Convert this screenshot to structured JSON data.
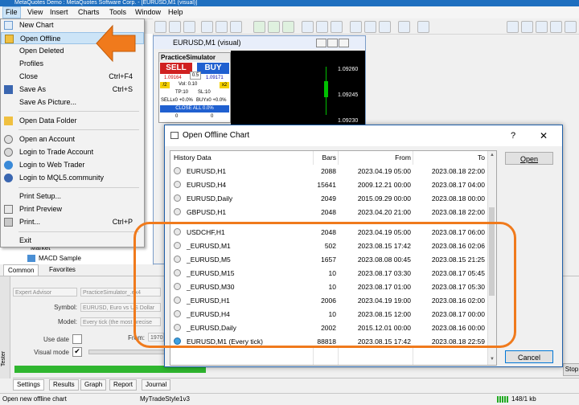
{
  "window_title": "MetaQuotes Demo : MetaQuotes Software Corp. - [EURUSD,M1 (visual)]",
  "menubar": [
    "File",
    "View",
    "Insert",
    "Charts",
    "Tools",
    "Window",
    "Help"
  ],
  "file_menu": [
    {
      "label": "New Chart",
      "shortcut": "",
      "icon": "new-chart-icon"
    },
    {
      "label": "Open Offline",
      "shortcut": "",
      "icon": "open-folder-icon"
    },
    {
      "label": "Open Deleted",
      "shortcut": "",
      "icon": ""
    },
    {
      "label": "Profiles",
      "shortcut": "",
      "icon": ""
    },
    {
      "label": "Close",
      "shortcut": "Ctrl+F4",
      "icon": ""
    },
    {
      "label": "Save As",
      "shortcut": "Ctrl+S",
      "icon": "save-icon"
    },
    {
      "label": "Save As Picture...",
      "shortcut": "",
      "icon": ""
    },
    {
      "label": "Open Data Folder",
      "shortcut": "",
      "icon": "folder-icon"
    },
    {
      "label": "Open an Account",
      "shortcut": "",
      "icon": "account-icon"
    },
    {
      "label": "Login to Trade Account",
      "shortcut": "",
      "icon": "login-icon"
    },
    {
      "label": "Login to Web Trader",
      "shortcut": "",
      "icon": "web-icon"
    },
    {
      "label": "Login to MQL5.community",
      "shortcut": "",
      "icon": "mql5-icon"
    },
    {
      "label": "Print Setup...",
      "shortcut": "",
      "icon": ""
    },
    {
      "label": "Print Preview",
      "shortcut": "",
      "icon": "print-preview-icon"
    },
    {
      "label": "Print...",
      "shortcut": "Ctrl+P",
      "icon": "print-icon"
    },
    {
      "label": "Exit",
      "shortcut": "",
      "icon": ""
    }
  ],
  "chart_window": {
    "title": "EURUSD,M1 (visual)",
    "prices": [
      "1.09260",
      "1.09245",
      "1.09230"
    ],
    "simulator": {
      "title": "PracticeSimulator",
      "sell": "SELL",
      "buy": "BUY",
      "bid": "1.09164",
      "spread": "0.5",
      "ask": "1.09171",
      "half": "/2",
      "vol": "Vol: 0.10",
      "double": "x2",
      "tp": "TP:10",
      "sl": "SL:10",
      "sell_pct": "SELLx0 +0.0%",
      "buy_pct": "BUYx0 +0.0%",
      "close_all": "CLOSE ALL 0.0%",
      "zero_left": "0",
      "zero_right": "0"
    }
  },
  "navigator": {
    "tree_items": [
      "Market",
      "MACD Sample"
    ],
    "tabs": [
      "Common",
      "Favorites"
    ]
  },
  "tester": {
    "type": "Expert Advisor",
    "ea": "PracticeSimulator_.ex4",
    "symbol_label": "Symbol:",
    "symbol": "EURUSD, Euro vs US Dollar",
    "model_label": "Model:",
    "model": "Every tick (the most precise",
    "use_date_label": "Use date",
    "from_label": "From:",
    "from_value": "1970",
    "visual_label": "Visual mode",
    "stop_button": "Stop",
    "side_label": "Tester",
    "tabs": [
      "Settings",
      "Results",
      "Graph",
      "Report",
      "Journal"
    ]
  },
  "status": {
    "left": "Open new offline chart",
    "profile": "MyTradeStyle1v3",
    "traffic": "148/1 kb"
  },
  "dialog": {
    "title": "Open Offline Chart",
    "help": "?",
    "close": "✕",
    "columns": [
      "History Data",
      "Bars",
      "From",
      "To"
    ],
    "rows": [
      [
        "EURUSD,H1",
        "2088",
        "2023.04.19 05:00",
        "2023.08.18 22:00"
      ],
      [
        "EURUSD,H4",
        "15641",
        "2009.12.21 00:00",
        "2023.08.17 04:00"
      ],
      [
        "EURUSD,Daily",
        "2049",
        "2015.09.29 00:00",
        "2023.08.18 00:00"
      ],
      [
        "GBPUSD,H1",
        "2048",
        "2023.04.20 21:00",
        "2023.08.18 22:00"
      ],
      [
        "USDCHF,H1",
        "2048",
        "2023.04.19 05:00",
        "2023.08.17 06:00"
      ],
      [
        "_EURUSD,M1",
        "502",
        "2023.08.15 17:42",
        "2023.08.16 02:06"
      ],
      [
        "_EURUSD,M5",
        "1657",
        "2023.08.08 00:45",
        "2023.08.15 21:25"
      ],
      [
        "_EURUSD,M15",
        "10",
        "2023.08.17 03:30",
        "2023.08.17 05:45"
      ],
      [
        "_EURUSD,M30",
        "10",
        "2023.08.17 01:00",
        "2023.08.17 05:30"
      ],
      [
        "_EURUSD,H1",
        "2006",
        "2023.04.19 19:00",
        "2023.08.16 02:00"
      ],
      [
        "_EURUSD,H4",
        "10",
        "2023.08.15 12:00",
        "2023.08.17 00:00"
      ],
      [
        "_EURUSD,Daily",
        "2002",
        "2015.12.01 00:00",
        "2023.08.16 00:00"
      ],
      [
        "EURUSD,M1 (Every tick)",
        "88818",
        "2023.08.15 17:42",
        "2023.08.18 22:59"
      ]
    ],
    "open_button": "Open",
    "cancel_button": "Cancel"
  },
  "colors": {
    "highlight": "#f07a1c",
    "arrow": "#f07a1c",
    "selection": "#cce4f7"
  }
}
